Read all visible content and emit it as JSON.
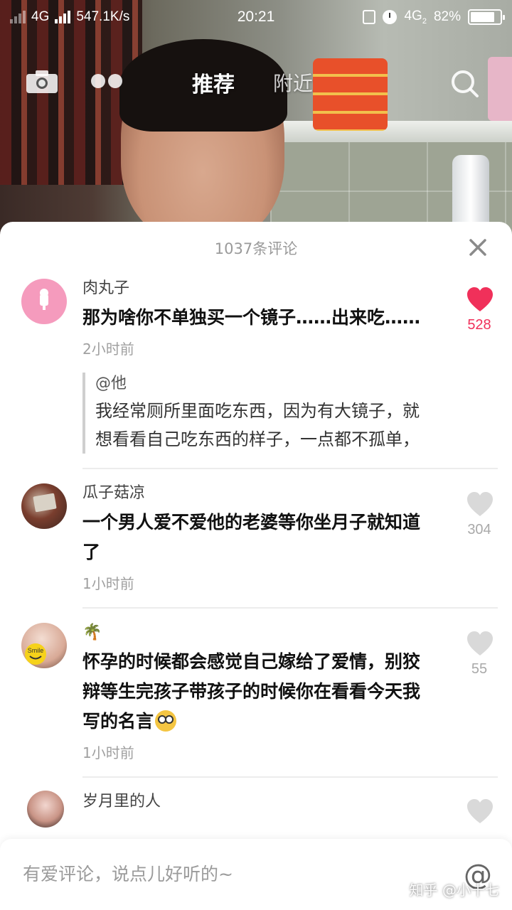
{
  "status_bar": {
    "network_1": "4G",
    "speed": "547.1K/s",
    "time": "20:21",
    "network_2": "4G",
    "sim": "2",
    "battery": "82%",
    "battery_level": 0.82
  },
  "top_nav": {
    "tab_recommend": "推荐",
    "tab_nearby": "附近",
    "icons": [
      "camera-icon",
      "dots-icon",
      "search-icon"
    ]
  },
  "sheet": {
    "count_label": "1037条评论"
  },
  "comments": [
    {
      "username": "肉丸子",
      "text": "那为啥你不单独买一个镜子……出来吃……",
      "time": "2小时前",
      "likes": "528",
      "liked": true,
      "reply": {
        "user": "@他",
        "text": "我经常厕所里面吃东西，因为有大镜子，就想看看自己吃东西的样子，一点都不孤单，"
      }
    },
    {
      "username": "瓜子菇凉",
      "text": "一个男人爱不爱他的老婆等你坐月子就知道了",
      "time": "1小时前",
      "likes": "304",
      "liked": false
    },
    {
      "username": "🌴",
      "text": "怀孕的时候都会感觉自己嫁给了爱情，别狡辩等生完孩子带孩子的时候你在看看今天我写的名言",
      "time": "1小时前",
      "likes": "55",
      "liked": false
    },
    {
      "username": "岁月里的人"
    }
  ],
  "avatar_badge": "Smile",
  "input": {
    "placeholder": "有爱评论，说点儿好听的~",
    "at_symbol": "@"
  },
  "watermark": "知乎 @小十七",
  "colors": {
    "like_active": "#f0305a",
    "like_inactive": "#d9d9d9",
    "count_inactive": "#a9a9a9",
    "sheet_bg": "#ffffff"
  }
}
